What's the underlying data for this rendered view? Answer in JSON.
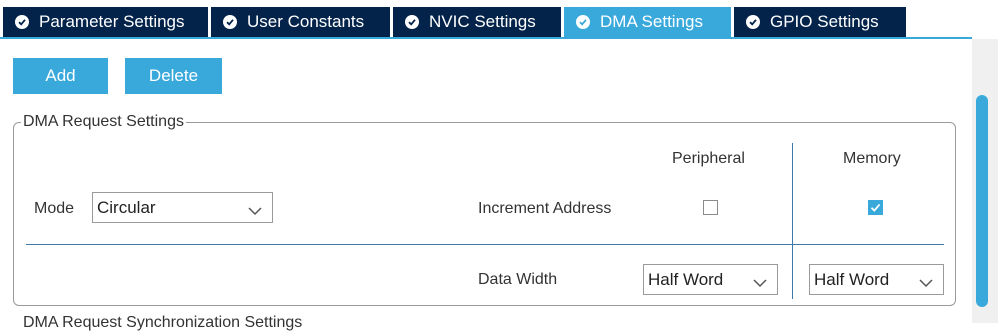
{
  "tabs": [
    {
      "label": "Parameter Settings",
      "active": false
    },
    {
      "label": "User Constants",
      "active": false
    },
    {
      "label": "NVIC Settings",
      "active": false
    },
    {
      "label": "DMA Settings",
      "active": true
    },
    {
      "label": "GPIO Settings",
      "active": false
    }
  ],
  "toolbar": {
    "add_label": "Add",
    "delete_label": "Delete"
  },
  "dma_request": {
    "legend": "DMA Request Settings",
    "mode_label": "Mode",
    "mode_value": "Circular",
    "peripheral_header": "Peripheral",
    "memory_header": "Memory",
    "increment_label": "Increment Address",
    "peripheral_increment": false,
    "memory_increment": true,
    "data_width_label": "Data Width",
    "peripheral_width": "Half Word",
    "memory_width": "Half Word"
  },
  "sync_legend": "DMA Request Synchronization Settings",
  "colors": {
    "accent": "#39a9dc",
    "tab_dark": "#03234b",
    "divider": "#3d79a8"
  },
  "icons": {
    "tab_icon": "check-circle-icon",
    "select_icon": "chevron-down-icon",
    "check_icon": "checkmark-icon"
  }
}
